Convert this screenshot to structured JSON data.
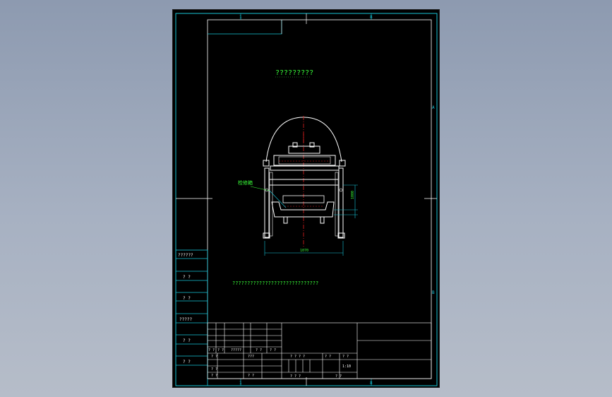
{
  "colors": {
    "background": "#000000",
    "frame": "#17c3d6",
    "outline": "#ffffff",
    "annotation": "#39ff39",
    "centerline": "#e02020"
  },
  "border_marks": {
    "top_col_1": "1",
    "top_col_2": "8",
    "bottom_col_1": "1",
    "bottom_col_2": "8",
    "right_row_a": "A",
    "right_row_b": "B"
  },
  "drawing": {
    "title": "?????????",
    "note": "?????????????????????????????",
    "leader_label": "检修箱",
    "dim_vertical": "1000",
    "dim_width": "1070"
  },
  "side_table": {
    "rows": [
      "??????",
      "? ?",
      "? ?",
      "?????",
      "? ?",
      "? ?"
    ]
  },
  "title_block": {
    "sign_row": [
      "? ?",
      "? ?",
      "?????",
      "? ?",
      "? ?"
    ],
    "left_rows": [
      {
        "a": "? ?",
        "b": "???"
      },
      {
        "a": "? ?",
        "b": ""
      },
      {
        "a": "? ?",
        "b": "? ?"
      }
    ],
    "stage_header": "? ? ? ?",
    "weight_header": "? ?",
    "scale_header": "? ?",
    "scale_value": "1:10",
    "sheet_left": "? ?   ?",
    "sheet_right": "? ?"
  }
}
